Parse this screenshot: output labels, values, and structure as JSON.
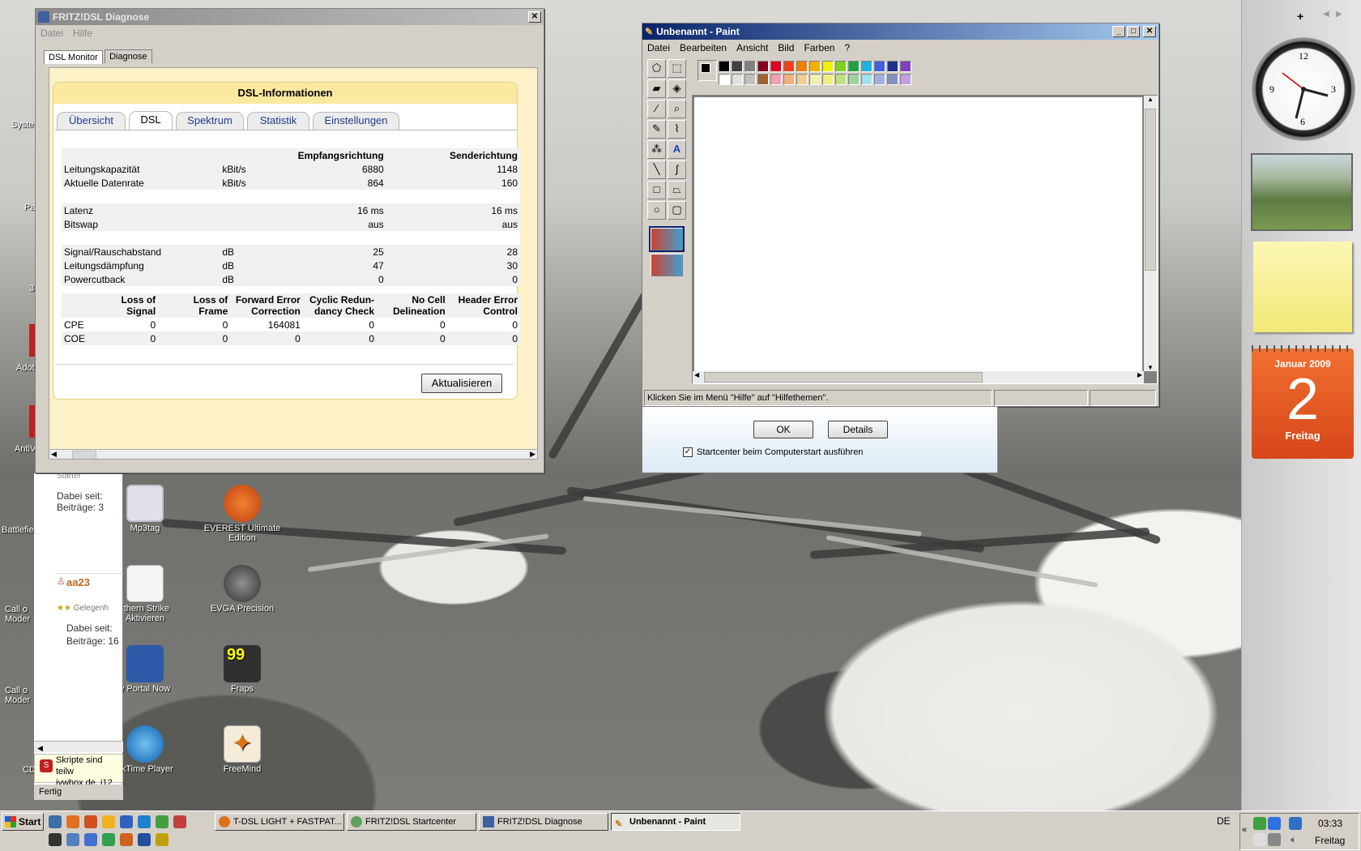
{
  "colors": {
    "title_active": "#0a246a",
    "fritz_yellow": "#fce9a0",
    "calendar_orange": "#e8541c",
    "tab_link": "#203a90"
  },
  "fritz": {
    "title": "FRITZ!DSL Diagnose",
    "menu": [
      "Datei",
      "Hilfe"
    ],
    "outer_tabs": [
      "DSL Monitor",
      "Diagnose"
    ],
    "panel_title": "DSL-Informationen",
    "tabs": [
      "Übersicht",
      "DSL",
      "Spektrum",
      "Statistik",
      "Einstellungen"
    ],
    "selected_tab": "DSL",
    "headers": {
      "rx": "Empfangsrichtung",
      "tx": "Senderichtung"
    },
    "rows": [
      {
        "label": "Leitungskapazität",
        "unit": "kBit/s",
        "rx": "6880",
        "tx": "1148"
      },
      {
        "label": "Aktuelle Datenrate",
        "unit": "kBit/s",
        "rx": "864",
        "tx": "160"
      },
      {
        "label": "Latenz",
        "unit": "",
        "rx": "16 ms",
        "tx": "16 ms"
      },
      {
        "label": "Bitswap",
        "unit": "",
        "rx": "aus",
        "tx": "aus"
      },
      {
        "label": "Signal/Rauschabstand",
        "unit": "dB",
        "rx": "25",
        "tx": "28"
      },
      {
        "label": "Leitungsdämpfung",
        "unit": "dB",
        "rx": "47",
        "tx": "30"
      },
      {
        "label": "Powercutback",
        "unit": "dB",
        "rx": "0",
        "tx": "0"
      }
    ],
    "err_headers": [
      [
        "Loss of",
        "Signal"
      ],
      [
        "Loss of",
        "Frame"
      ],
      [
        "Forward Error",
        "Correction"
      ],
      [
        "Cyclic Redun-",
        "dancy Check"
      ],
      [
        "No Cell",
        "Delineation"
      ],
      [
        "Header Error",
        "Control"
      ]
    ],
    "err_rows": [
      {
        "label": "CPE",
        "values": [
          "0",
          "0",
          "164081",
          "0",
          "0",
          "0"
        ]
      },
      {
        "label": "COE",
        "values": [
          "0",
          "0",
          "0",
          "0",
          "0",
          "0"
        ]
      }
    ],
    "refresh_label": "Aktualisieren"
  },
  "paint": {
    "title": "Unbenannt - Paint",
    "menu": [
      "Datei",
      "Bearbeiten",
      "Ansicht",
      "Bild",
      "Farben",
      "?"
    ],
    "status": "Klicken Sie im Menü \"Hilfe\" auf \"Hilfethemen\".",
    "tools": [
      "free-select",
      "rect-select",
      "eraser",
      "fill",
      "picker",
      "magnifier",
      "pencil",
      "brush",
      "airbrush",
      "text",
      "line",
      "curve",
      "rectangle",
      "polygon",
      "ellipse",
      "rounded-rect"
    ],
    "palette_top": [
      "#000000",
      "#404040",
      "#808080",
      "#800020",
      "#e00020",
      "#f04020",
      "#f08000",
      "#f0b000",
      "#f0f000",
      "#80d020",
      "#20a040",
      "#20b0e0",
      "#4060e0",
      "#203090",
      "#8040c0"
    ],
    "palette_bottom": [
      "#ffffff",
      "#e0e0e0",
      "#c0c0c0",
      "#a06030",
      "#f0a0b0",
      "#f0b080",
      "#f0d090",
      "#f0f0b0",
      "#f0f080",
      "#c0e080",
      "#a0d0a0",
      "#a0e0f0",
      "#a0b0e0",
      "#8090c0",
      "#c0a0e0"
    ]
  },
  "startcenter": {
    "ok": "OK",
    "details": "Details",
    "checkbox": "Startcenter beim Computerstart ausführen"
  },
  "browser": {
    "lines": [
      "Starter",
      "Dabei seit:",
      "Beiträge: 3"
    ],
    "user": "aa23",
    "rank": "Gelegenh",
    "lines2": [
      "Dabei seit:",
      "Beiträge: 16"
    ],
    "notice1": "Skripte sind teilw",
    "notice2": "ivwbox.de, i12.",
    "status": "Fertig"
  },
  "desktop_icons": [
    {
      "label": "Mp3tag",
      "color": "#e0e0e8"
    },
    {
      "label": "EVEREST Ultimate Edition",
      "color": "#d05010"
    },
    {
      "label": "rthern Strike Aktivieren",
      "color": "#f0f0f0"
    },
    {
      "label": "EVGA Precision",
      "color": "#505050"
    },
    {
      "label": "y Portal Now",
      "color": "#3060b0"
    },
    {
      "label": "Fraps",
      "color": "#303030"
    },
    {
      "label": "ckTime Player",
      "color": "#2080d0"
    },
    {
      "label": "FreeMind",
      "color": "#f0e0c0"
    }
  ],
  "left_edge_labels": [
    "Syste",
    "Pa",
    "3",
    "Adob",
    "AntiV",
    "Battlefie",
    "Call o Moder",
    "Call o Moder",
    "CD"
  ],
  "sidebar": {
    "cal_month": "Januar 2009",
    "cal_day": "2",
    "cal_weekday": "Freitag",
    "plus": "+"
  },
  "taskbar": {
    "start": "Start",
    "tasks": [
      "T-DSL LIGHT + FASTPAT...",
      "FRITZ!DSL Startcenter",
      "FRITZ!DSL Diagnose",
      "Unbenannt - Paint"
    ],
    "active_task": 3,
    "lang": "DE",
    "time": "03:33",
    "day": "Freitag"
  }
}
